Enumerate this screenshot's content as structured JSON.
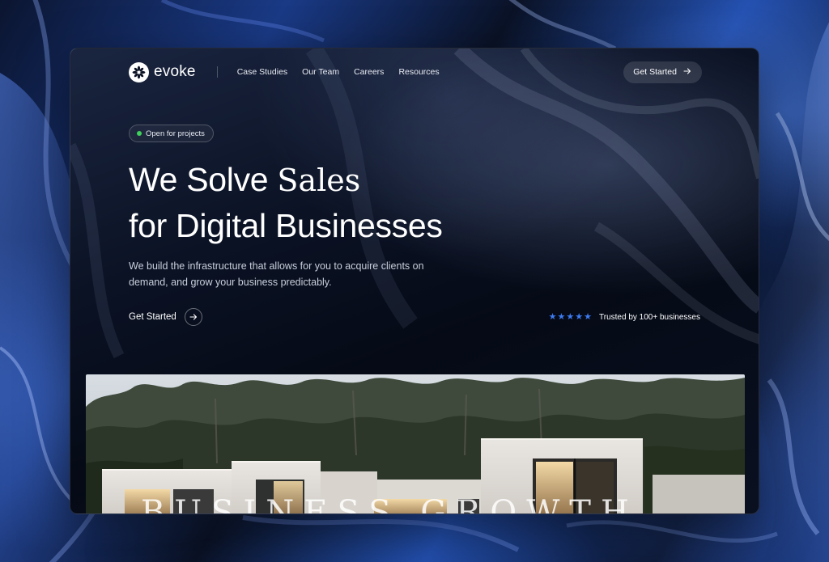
{
  "brand": {
    "name": "evoke"
  },
  "nav": {
    "links": [
      "Case Studies",
      "Our Team",
      "Careers",
      "Resources"
    ],
    "cta_label": "Get Started"
  },
  "badge": {
    "label": "Open for projects",
    "status_color": "#3fd15c"
  },
  "hero": {
    "headline_line1_sans": "We Solve ",
    "headline_line1_serif": "Sales",
    "headline_line2": "for Digital Businesses",
    "subtext": "We build the infrastructure that allows for you to acquire clients on demand, and grow your business predictably.",
    "cta_label": "Get Started",
    "rating_stars": 5,
    "trust_text": "Trusted by 100+ businesses",
    "watermark_text": "BUSINESS GROWTH"
  },
  "colors": {
    "accent": "#3d7bf2",
    "star": "#3d7bf2"
  },
  "icons": {
    "logo": "asterisk-flower-icon",
    "nav_cta": "arrow-right-icon",
    "hero_cta": "arrow-right-circle-icon",
    "rating": "star-icon"
  }
}
